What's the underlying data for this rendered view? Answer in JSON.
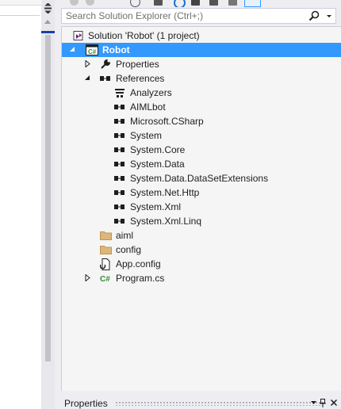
{
  "search": {
    "placeholder": "Search Solution Explorer (Ctrl+;)"
  },
  "tree": {
    "solution": "Solution 'Robot' (1 project)",
    "project": "Robot",
    "properties": "Properties",
    "references": "References",
    "reference_items": [
      "Analyzers",
      "AIMLbot",
      "Microsoft.CSharp",
      "System",
      "System.Core",
      "System.Data",
      "System.Data.DataSetExtensions",
      "System.Net.Http",
      "System.Xml",
      "System.Xml.Linq"
    ],
    "folders": [
      "aiml",
      "config"
    ],
    "app_config": "App.config",
    "program": "Program.cs"
  },
  "properties_panel": {
    "title": "Properties"
  },
  "colors": {
    "selection": "#3399ff",
    "csharp_green": "#388a34",
    "folder": "#dcb67a"
  }
}
